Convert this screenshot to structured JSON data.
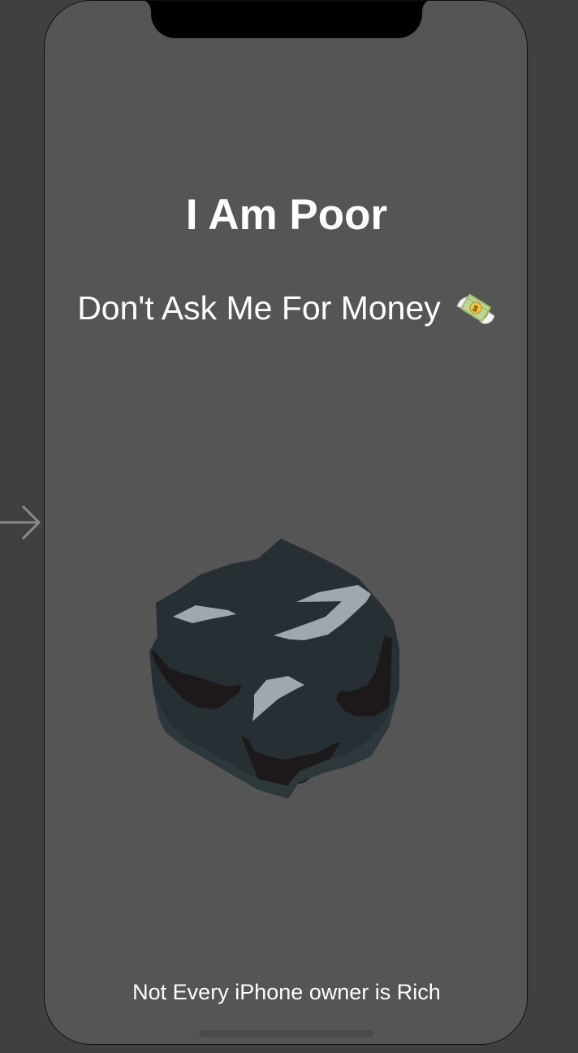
{
  "screen": {
    "title": "I Am Poor",
    "subtitle": "Don't Ask Me For Money",
    "subtitle_icon": "money-with-wings-icon",
    "main_image": "coal-image",
    "footer": "Not Every iPhone owner is Rich"
  },
  "colors": {
    "canvas_background": "#404040",
    "screen_background": "#555555",
    "text": "#ffffff",
    "coal_body": "#252d30",
    "coal_highlight": "#9ea5ad",
    "coal_shadow": "#1d191b"
  }
}
